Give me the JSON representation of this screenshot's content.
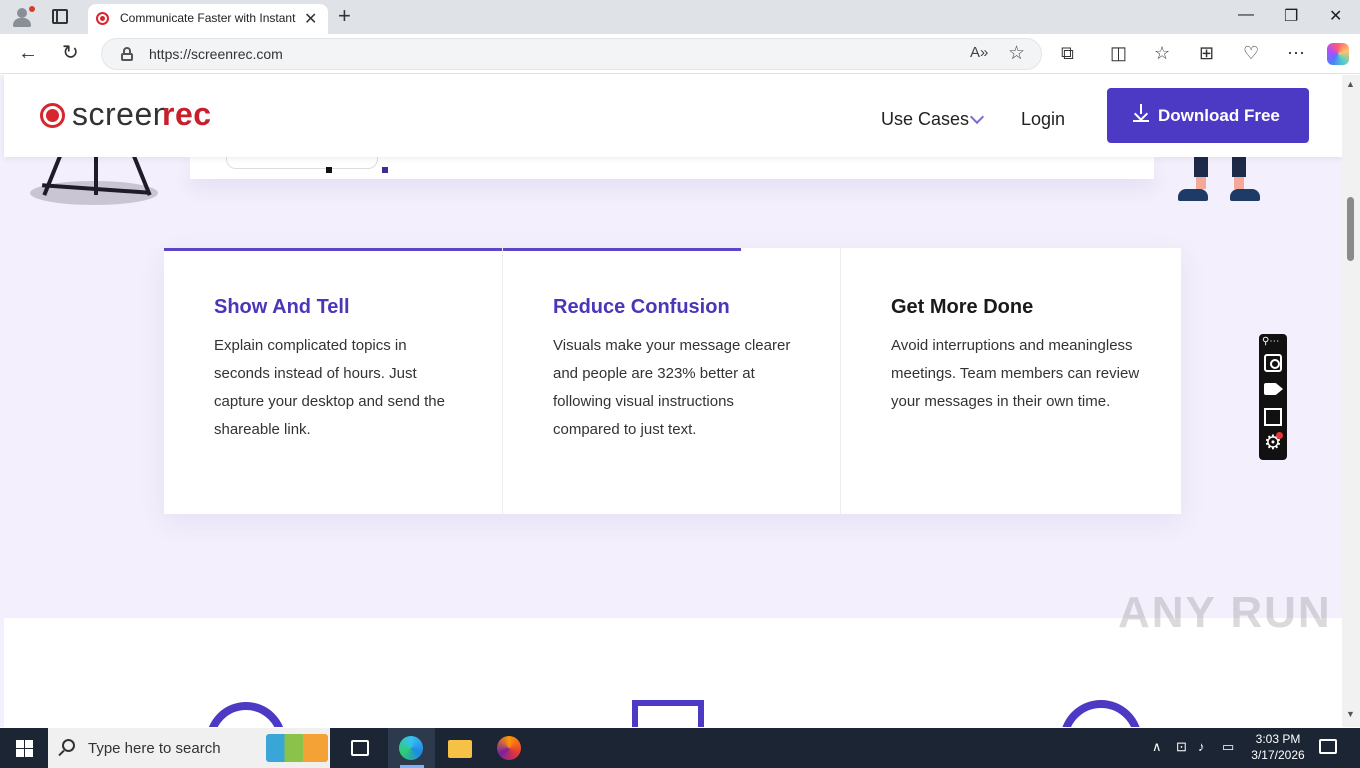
{
  "browser": {
    "tab_title": "Communicate Faster with Instant",
    "url": "https://screenrec.com",
    "read_aloud_label": "A»"
  },
  "site": {
    "logo": {
      "part1": "screen",
      "part2": "rec"
    },
    "nav": {
      "use_cases": "Use Cases",
      "login": "Login"
    },
    "download_button": "Download Free"
  },
  "features": [
    {
      "title": "Show And Tell",
      "text": "Explain complicated topics in seconds instead of hours. Just capture your desktop and send the shareable link.",
      "title_color": "#4b36b8"
    },
    {
      "title": "Reduce Confusion",
      "text": "Visuals make your message clearer and people are 323% better at following visual instructions compared to just text.",
      "title_color": "#4b36b8"
    },
    {
      "title": "Get More Done",
      "text": "Avoid interruptions and meaningless meetings. Team members can review your messages in their own time.",
      "title_color": "#1a1a1a"
    }
  ],
  "watermark": "ANY RUN",
  "taskbar": {
    "search_placeholder": "Type here to search",
    "time": "3:03 PM",
    "date": "3/17/2026"
  },
  "colors": {
    "brand_red": "#d8262f",
    "brand_purple": "#4c39c4",
    "page_bg": "#f3effc"
  }
}
